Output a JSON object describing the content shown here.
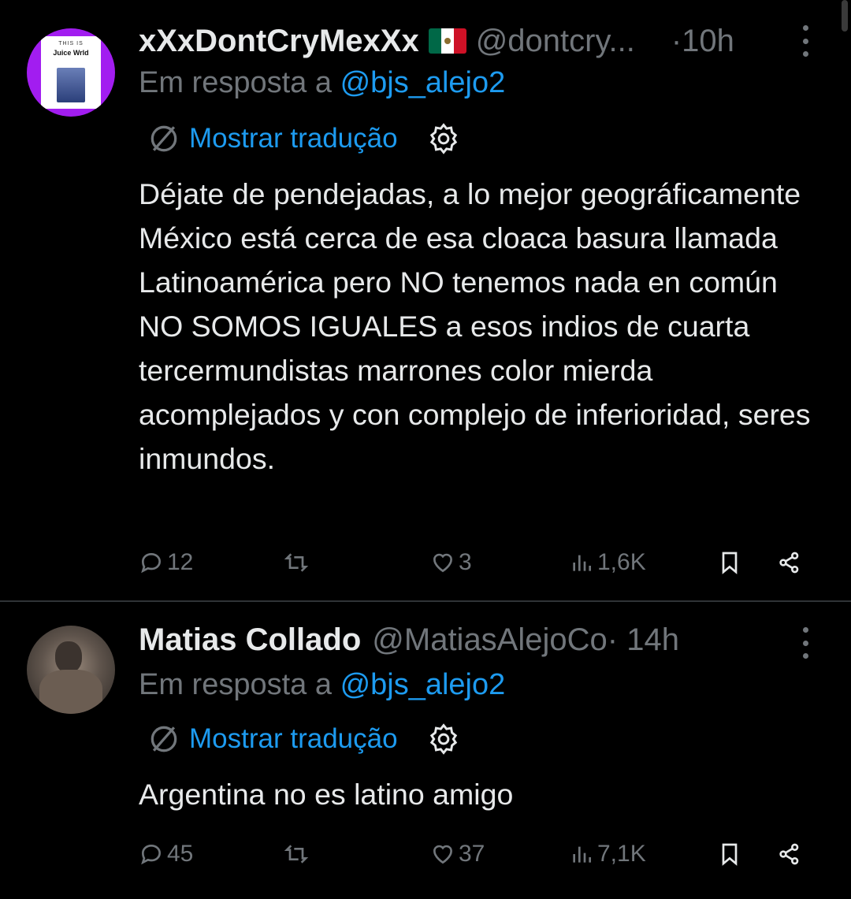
{
  "tweets": [
    {
      "display_name": "xXxDontCryMexXx",
      "handle": "@dontcry...",
      "time": "·10h",
      "reply_prefix": "Em resposta a",
      "reply_to": "@bjs_alejo2",
      "translate_label": "Mostrar tradução",
      "text": "Déjate de pendejadas, a lo mejor geográficamente México está cerca de esa cloaca basura llamada Latinoamérica pero NO tenemos nada en común NO SOMOS IGUALES a esos indios de cuarta tercermundistas marrones color mierda acomplejados y con complejo de inferioridad,  seres inmundos.",
      "avatar": {
        "label_top": "THIS IS",
        "label_main": "Juice Wrld",
        "color": "#a21df0"
      },
      "flag_colors": [
        "#006847",
        "#ffffff",
        "#ce1126"
      ],
      "stats": {
        "replies": "12",
        "retweets": "",
        "likes": "3",
        "views": "1,6K"
      }
    },
    {
      "display_name": "Matias Collado",
      "handle": "@MatiasAlejoCo",
      "time": " · 14h",
      "reply_prefix": "Em resposta a",
      "reply_to": "@bjs_alejo2",
      "translate_label": "Mostrar tradução",
      "text": "Argentina no es latino amigo",
      "stats": {
        "replies": "45",
        "retweets": "",
        "likes": "37",
        "views": "7,1K"
      }
    }
  ],
  "icons": [
    "reply-icon",
    "retweet-icon",
    "like-icon",
    "views-icon",
    "bookmark-icon",
    "share-icon",
    "translate-icon",
    "gear-icon",
    "more-icon"
  ],
  "colors": {
    "background": "#000000",
    "text": "#e7e9ea",
    "muted": "#71767b",
    "accent": "#1d9bf0",
    "divider": "#2f3336"
  }
}
